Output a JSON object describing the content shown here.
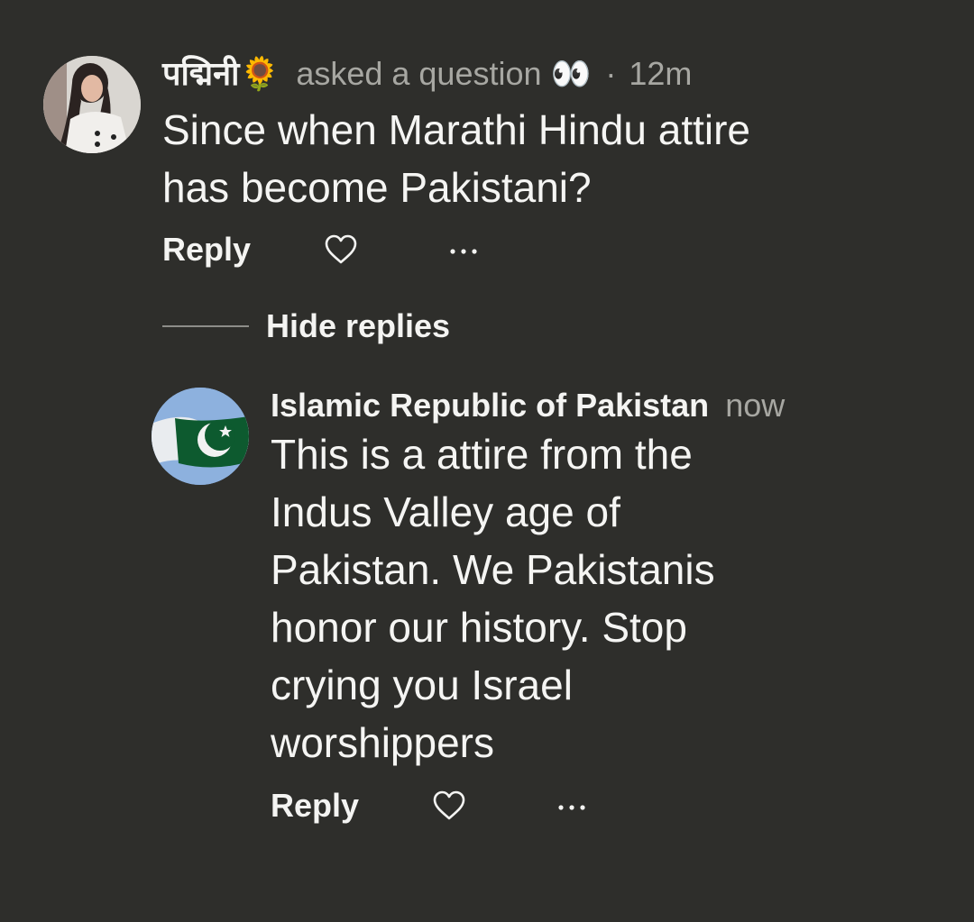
{
  "comment": {
    "username": "पद्मिनी🌻",
    "action": "asked a question 👀",
    "separator": "·",
    "time": "12m",
    "text": "Since when Marathi Hindu attire\nhas become Pakistani?",
    "reply_label": "Reply",
    "like_icon": "heart-outline-icon",
    "more_icon": "ellipsis-icon"
  },
  "thread": {
    "hide_replies_label": "Hide replies"
  },
  "reply": {
    "username": "Islamic Republic of Pakistan",
    "time": "now",
    "text": "This is a attire from the\nIndus Valley age of\nPakistan. We Pakistanis\nhonor our history. Stop\ncrying you Israel\nworshippers",
    "reply_label": "Reply",
    "like_icon": "heart-outline-icon",
    "more_icon": "ellipsis-icon"
  },
  "colors": {
    "background": "#2e2e2b",
    "text": "#f5f5f3",
    "muted": "#a7a7a2",
    "flag_green": "#01411c"
  }
}
